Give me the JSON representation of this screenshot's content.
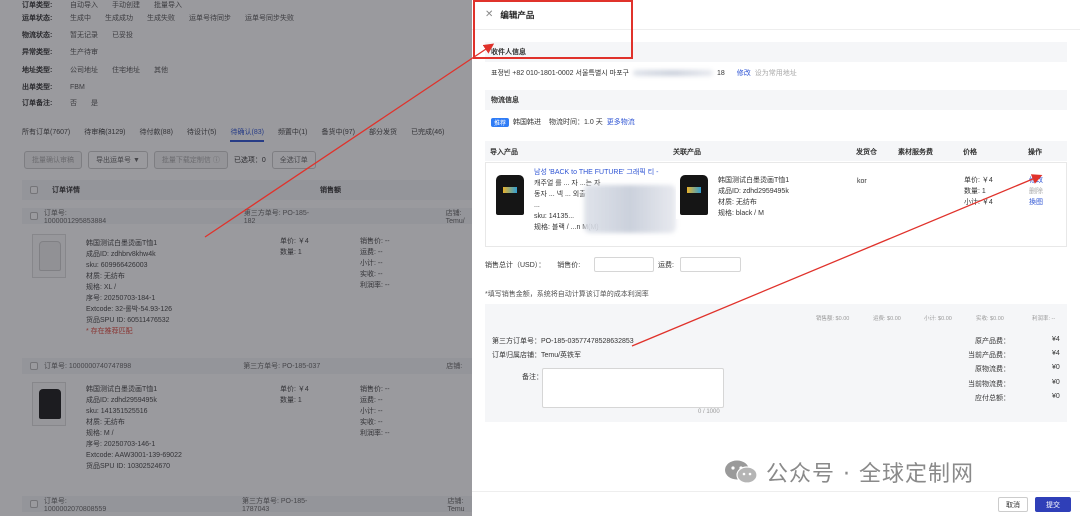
{
  "filters": [
    {
      "label": "订单类型:",
      "options": [
        "自动导入",
        "手动创建",
        "批量导入"
      ]
    },
    {
      "label": "运单状态:",
      "options": [
        "生成中",
        "生成成功",
        "生成失败",
        "运单号待同步",
        "运单号同步失败"
      ]
    },
    {
      "label": "物流状态:",
      "options": [
        "暂无记录",
        "已妥投"
      ]
    },
    {
      "label": "异常类型:",
      "options": [
        "生产待审"
      ]
    },
    {
      "label": "地址类型:",
      "options": [
        "公司地址",
        "住宅地址",
        "其他"
      ]
    },
    {
      "label": "出单类型:",
      "options": [
        "FBM"
      ]
    },
    {
      "label": "订单备注:",
      "options": [
        "否",
        "是"
      ]
    }
  ],
  "tabs": [
    "所有订单(7607)",
    "待审稿(3129)",
    "待付款(88)",
    "待设计(5)",
    "待确认(83)",
    "频置中(1)",
    "备货中(97)",
    "部分发货",
    "已完成(46)"
  ],
  "active_tab_index": 4,
  "toolbar": {
    "batch_confirm": "批量确认审稿",
    "export": "导出运单号 ▼",
    "batch_download": "批量下载定制信 ⓘ",
    "selected": "已选项：0",
    "select_all": "全选订单"
  },
  "table": {
    "col_details": "订单详情",
    "col_sales": "销售额"
  },
  "orders": [
    {
      "order_no": "订单号: 1000001295853884",
      "third_party": "第三方单号: PO-185-182",
      "store": "店铺: Temu/",
      "lines": [
        "韩国测试白墨烫画T恤1",
        "成品ID: zdhbrv8khw4k",
        "sku: 609966426003",
        "材质: 无纺布",
        "规格: XL /",
        "序号: 20250703-184-1",
        "Extcode: 32-롤박-54.93-126",
        "货品SPU ID: 60511476532"
      ],
      "warn": "* 存在推荐匹配",
      "price_lines": [
        "单价: ￥4",
        "数量: 1"
      ],
      "sales_lines": [
        "销售价: --",
        "运费: --",
        "小计: --",
        "实收: --",
        "利润率: --"
      ]
    },
    {
      "order_no": "订单号: 1000000740747898",
      "third_party": "第三方单号: PO-185-037",
      "store": "店铺:",
      "lines": [
        "韩国测试白墨烫画T恤1",
        "成品ID: zdhd2959495k",
        "sku: 141351525516",
        "材质: 无纺布",
        "规格: M /",
        "序号: 20250703-146-1",
        "Extcode: AAW3001-139-69022",
        "货品SPU ID: 10302524670"
      ],
      "price_lines": [
        "单价: ￥4",
        "数量: 1"
      ],
      "sales_lines": [
        "销售价: --",
        "运费: --",
        "小计: --",
        "实收: --",
        "利润率: --"
      ]
    },
    {
      "order_no": "订单号: 1000002070808559",
      "third_party": "第三方单号: PO-185-1787043",
      "store": "店铺: Temu"
    }
  ],
  "drawer": {
    "title": "编辑产品",
    "recipient_title": "收件人信息",
    "recipient_text": "표정빈 +82 010-1801-0002 서울특별시 마포구 ",
    "recipient_code": "18",
    "recipient_edit": "修改",
    "recipient_default": "设为常用地址",
    "logistics_title": "物流信息",
    "logistics_tag": "推荐",
    "logistics_name": "韩国韩进",
    "logistics_time": "物流时间：1.0 天",
    "logistics_more": "更多物流",
    "product_cols": [
      "导入产品",
      "关联产品",
      "发货仓",
      "素材服务费",
      "价格",
      "操作"
    ],
    "imported_lines": [
      "남성 'BACK to THE FUTURE' 그래픽 티 -",
      "캐주얼 를 ... 자 ...는 자",
      "동자 ... 넥 ... 외출",
      "...",
      "sku: 14135...",
      "规格: 블랙 / ...n M(M)"
    ],
    "linked_lines": [
      "韩国测试白墨烫画T恤1",
      "成品ID: zdhd2959495k",
      "材质: 无纺布",
      "规格: black / M"
    ],
    "warehouse": "kor",
    "price_lines": [
      "单价: ￥4",
      "数量: 1",
      "小计: ￥4"
    ],
    "ops": [
      "修改",
      "删除",
      "換图"
    ],
    "total_sales_label": "销售总计（USD）：",
    "sale_price_label": "销售价:",
    "shipping_label": "运费:",
    "note_hint": "*填写销售金额，系统将自动计算该订单的成本利润率",
    "summary": [
      "销售额: $0.00",
      "运费: $0.00",
      "小计: $0.00",
      "实收: $0.00",
      "利润率: --"
    ],
    "third_party": "第三方订单号：PO-185-03577478528632853",
    "store": "订单归属店铺：Temu/英铁军",
    "remark_label": "备注：",
    "remark_counter": "0 / 1000",
    "costs": [
      {
        "label": "原产品费：",
        "value": "¥4"
      },
      {
        "label": "当前产品费：",
        "value": "¥4"
      },
      {
        "label": "原物流费：",
        "value": "¥0"
      },
      {
        "label": "当前物流费：",
        "value": "¥0"
      },
      {
        "label": "应付总额：",
        "value": "¥0"
      }
    ],
    "cancel": "取消",
    "submit": "提交"
  },
  "watermark": {
    "text": "公众号 · 全球定制网"
  },
  "colors": {
    "accent": "#2f55d4",
    "submit": "#2f3fb8",
    "annotation": "#e0322b",
    "overlay": "rgba(30,32,40,0.45)"
  }
}
